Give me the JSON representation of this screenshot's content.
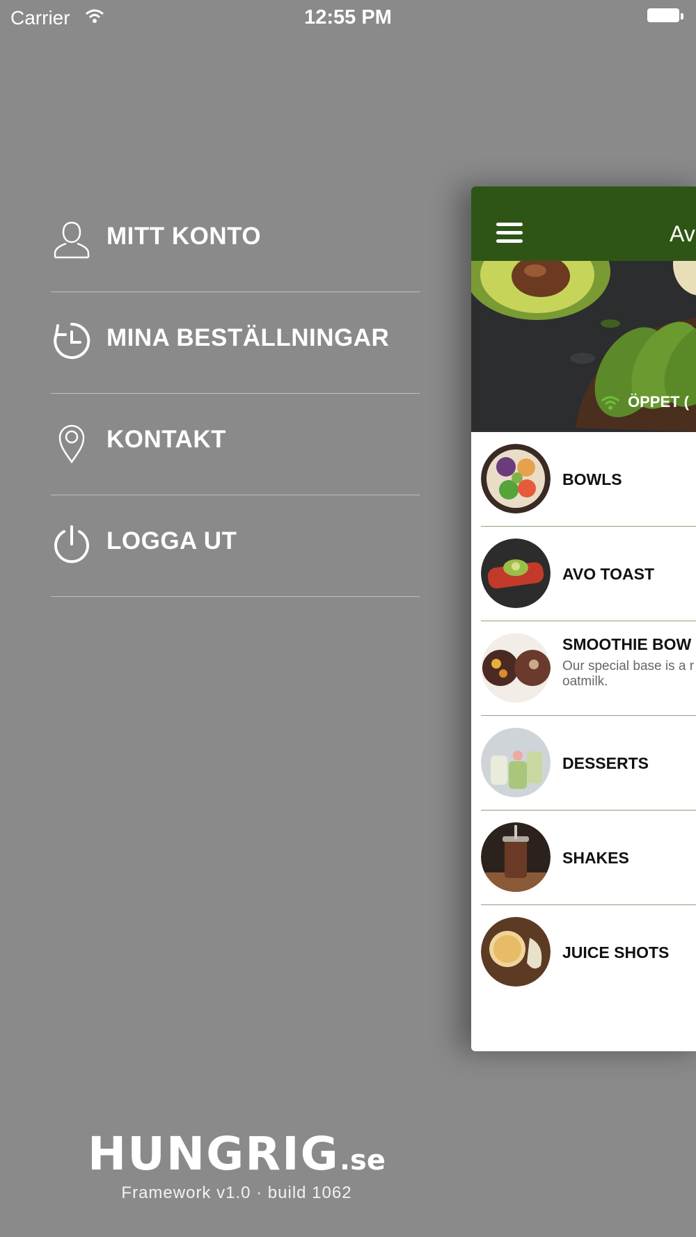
{
  "status_bar": {
    "carrier": "Carrier",
    "time": "12:55 PM"
  },
  "menu": [
    {
      "label": "MITT KONTO",
      "icon": "user-icon"
    },
    {
      "label": "MINA BESTÄLLNINGAR",
      "icon": "history-icon"
    },
    {
      "label": "KONTAKT",
      "icon": "location-pin-icon"
    },
    {
      "label": "LOGGA UT",
      "icon": "power-icon"
    }
  ],
  "brand": {
    "logo": "HUNGRIG",
    "tld": ".se",
    "build": "Framework v1.0 · build 1062"
  },
  "panel": {
    "title": "Av",
    "open_status": "ÖPPET (",
    "categories": [
      {
        "name": "BOWLS",
        "desc": ""
      },
      {
        "name": "AVO TOAST",
        "desc": ""
      },
      {
        "name": "SMOOTHIE BOW",
        "desc": "Our special base is a r oatmilk."
      },
      {
        "name": "DESSERTS",
        "desc": ""
      },
      {
        "name": "SHAKES",
        "desc": ""
      },
      {
        "name": "JUICE SHOTS",
        "desc": ""
      }
    ]
  },
  "colors": {
    "background": "#8a8a8a",
    "brand_green": "#2e5516",
    "open_green": "#6fbf3a",
    "divider": "#8aa07b"
  }
}
